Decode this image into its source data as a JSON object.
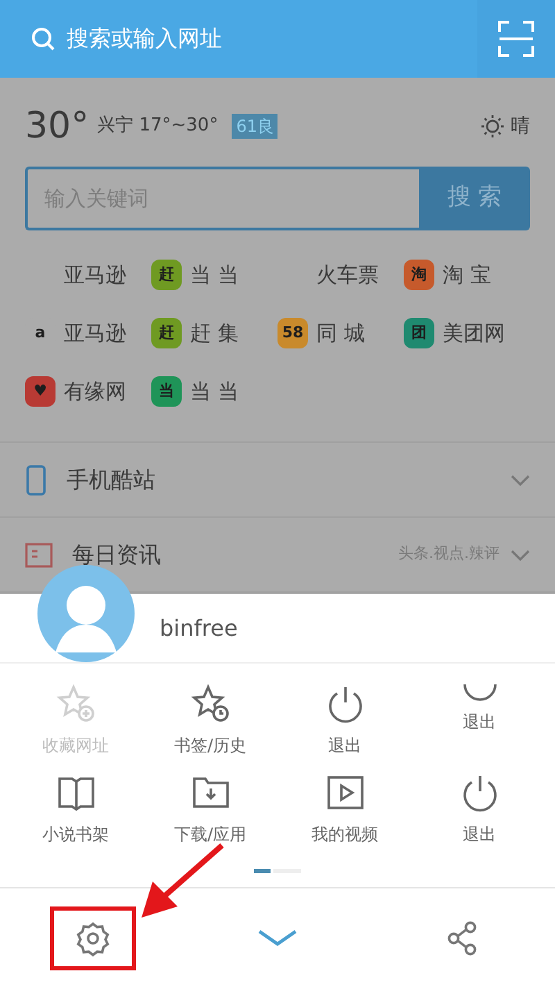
{
  "address_bar": {
    "placeholder": "搜索或输入网址"
  },
  "weather": {
    "temperature": "30°",
    "city_range": "兴宁 17°~30°",
    "air_quality": "61良",
    "condition": "晴"
  },
  "search": {
    "placeholder": "输入关键词",
    "button": "搜 索"
  },
  "links": [
    {
      "label": "亚马逊"
    },
    {
      "label": "当 当",
      "icon_text": "赶",
      "color": "#6f9a22"
    },
    {
      "label": "火车票"
    },
    {
      "label": "淘 宝",
      "icon_text": "淘",
      "color": "#c65a2c"
    },
    {
      "label": "亚马逊",
      "icon_text": "a",
      "color": "#ababab"
    },
    {
      "label": "赶 集",
      "icon_text": "赶",
      "color": "#6f9a22"
    },
    {
      "label": "同 城",
      "icon_text": "58",
      "color": "#c98a2c"
    },
    {
      "label": "美团网",
      "icon_text": "团",
      "color": "#1f8a70"
    },
    {
      "label": "有缘网",
      "icon_text": "♥",
      "color": "#b83a34"
    },
    {
      "label": "当 当",
      "icon_text": "当",
      "color": "#1f9458"
    }
  ],
  "sections": [
    {
      "kind": "phone",
      "title": "手机酷站",
      "expanded": false
    },
    {
      "kind": "news",
      "title": "每日资讯",
      "subtitle": "头条.视点.辣评",
      "expanded": false
    }
  ],
  "profile": {
    "username": "binfree"
  },
  "menu": [
    {
      "kind": "star-plus",
      "label": "收藏网址",
      "disabled": true
    },
    {
      "kind": "star-clock",
      "label": "书签/历史",
      "disabled": false
    },
    {
      "kind": "power",
      "label": "退出",
      "disabled": false
    },
    {
      "kind": "arc",
      "label": "退出",
      "disabled": false
    },
    {
      "kind": "book",
      "label": "小说书架",
      "disabled": false
    },
    {
      "kind": "folder",
      "label": "下载/应用",
      "disabled": false
    },
    {
      "kind": "video",
      "label": "我的视频",
      "disabled": false
    },
    {
      "kind": "power",
      "label": "退出",
      "disabled": false
    }
  ],
  "pages": [
    {
      "selected": true
    },
    {
      "selected": false
    }
  ],
  "toolbar": [
    {
      "kind": "settings",
      "highlighted": true
    },
    {
      "kind": "collapse",
      "highlighted": false
    },
    {
      "kind": "share",
      "highlighted": false
    }
  ]
}
